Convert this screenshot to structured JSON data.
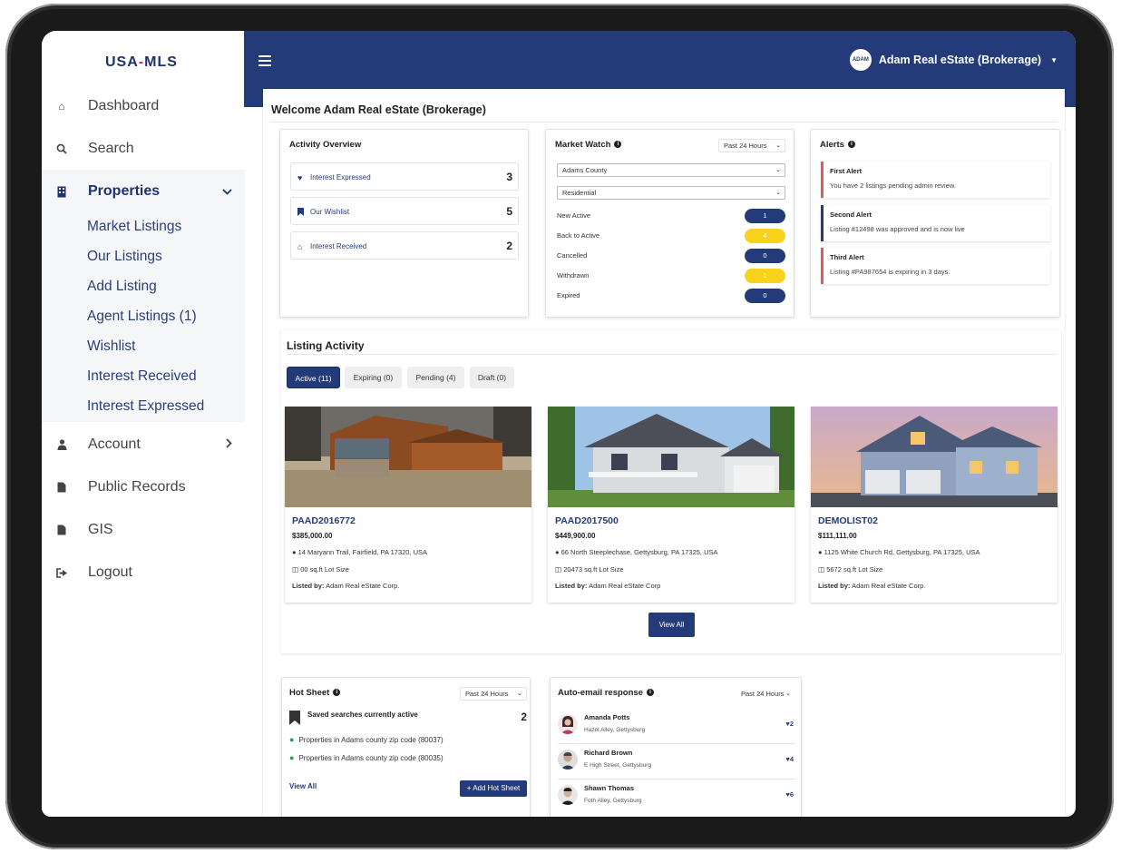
{
  "brand": {
    "logo_left": "USA",
    "logo_dash": "-",
    "logo_right": "MLS"
  },
  "sidebar": {
    "items": [
      {
        "label": "Dashboard"
      },
      {
        "label": "Search"
      },
      {
        "label": "Properties"
      },
      {
        "label": "Account"
      },
      {
        "label": "Public Records"
      },
      {
        "label": "GIS"
      },
      {
        "label": "Logout"
      }
    ],
    "properties_sub": [
      "Market Listings",
      "Our Listings",
      "Add Listing",
      "Agent Listings (1)",
      "Wishlist",
      "Interest Received",
      "Interest Expressed"
    ]
  },
  "header": {
    "user_name": "Adam Real eState (Brokerage)",
    "avatar_text": "ADAM"
  },
  "welcome": "Welcome Adam Real eState (Brokerage)",
  "activity": {
    "title": "Activity Overview",
    "rows": [
      {
        "label": "Interest Expressed",
        "count": "3"
      },
      {
        "label": "Our Wishlist",
        "count": "5"
      },
      {
        "label": "Interest Received",
        "count": "2"
      }
    ]
  },
  "market_watch": {
    "title": "Market Watch",
    "period": "Past 24 Hours",
    "county": "Adams County",
    "type": "Residential",
    "rows": [
      {
        "label": "New Active",
        "value": "1",
        "color": "#233b79"
      },
      {
        "label": "Back to Active",
        "value": "4",
        "color": "#f8d21b"
      },
      {
        "label": "Cancelled",
        "value": "0",
        "color": "#233b79"
      },
      {
        "label": "Withdrawn",
        "value": "1",
        "color": "#f8d21b"
      },
      {
        "label": "Expired",
        "value": "0",
        "color": "#233b79"
      }
    ]
  },
  "alerts": {
    "title": "Alerts",
    "items": [
      {
        "title": "First Alert",
        "message": "You have 2 listings pending admin review.",
        "color": "#e05a5a"
      },
      {
        "title": "Second Alert",
        "message": "Listing #12498 was approved and is now live",
        "color": "#233b79"
      },
      {
        "title": "Third Alert",
        "message": "Listing #PA987654 is expiring in 3 days.",
        "color": "#e05a5a"
      }
    ]
  },
  "listing_activity": {
    "title": "Listing Activity",
    "tabs": [
      "Active (11)",
      "Expiring (0)",
      "Pending (4)",
      "Draft (0)"
    ],
    "listings": [
      {
        "code": "PAAD2016772",
        "price": "$385,000.00",
        "address": "14 Maryann Trail, Fairfield, PA 17320, USA",
        "lot": "00 sq.ft Lot Size",
        "by_label": "Listed by:",
        "by": "Adam Real eState Corp."
      },
      {
        "code": "PAAD2017500",
        "price": "$449,900.00",
        "address": "66 North Steeplechase, Gettysburg, PA 17325, USA",
        "lot": "20473 sq.ft Lot Size",
        "by_label": "Listed by:",
        "by": "Adam Real eState Corp"
      },
      {
        "code": "DEMOLIST02",
        "price": "$111,111.00",
        "address": "1125 White Church Rd, Gettysburg, PA 17325, USA",
        "lot": "5672 sq.ft Lot Size",
        "by_label": "Listed by:",
        "by": "Adam Real eState Corp."
      }
    ],
    "view_all": "View All"
  },
  "hot_sheet": {
    "title": "Hot Sheet",
    "period": "Past 24 Hours",
    "saved_label": "Saved searches currently active",
    "saved_count": "2",
    "searches": [
      "Properties in Adams county zip code (80037)",
      "Properties in Adams county zip code (80035)"
    ],
    "view_all": "View All",
    "add_button": "Add Hot Sheet"
  },
  "auto_email": {
    "title": "Auto-email response",
    "period": "Past 24 Hours",
    "people": [
      {
        "name": "Amanda Potts",
        "address": "Hazel Alley, Gettysburg",
        "likes": "2"
      },
      {
        "name": "Richard Brown",
        "address": "E High Street, Gettysburg",
        "likes": "4"
      },
      {
        "name": "Shawn Thomas",
        "address": "Foth Alley, Gettysburg",
        "likes": "6"
      }
    ]
  }
}
